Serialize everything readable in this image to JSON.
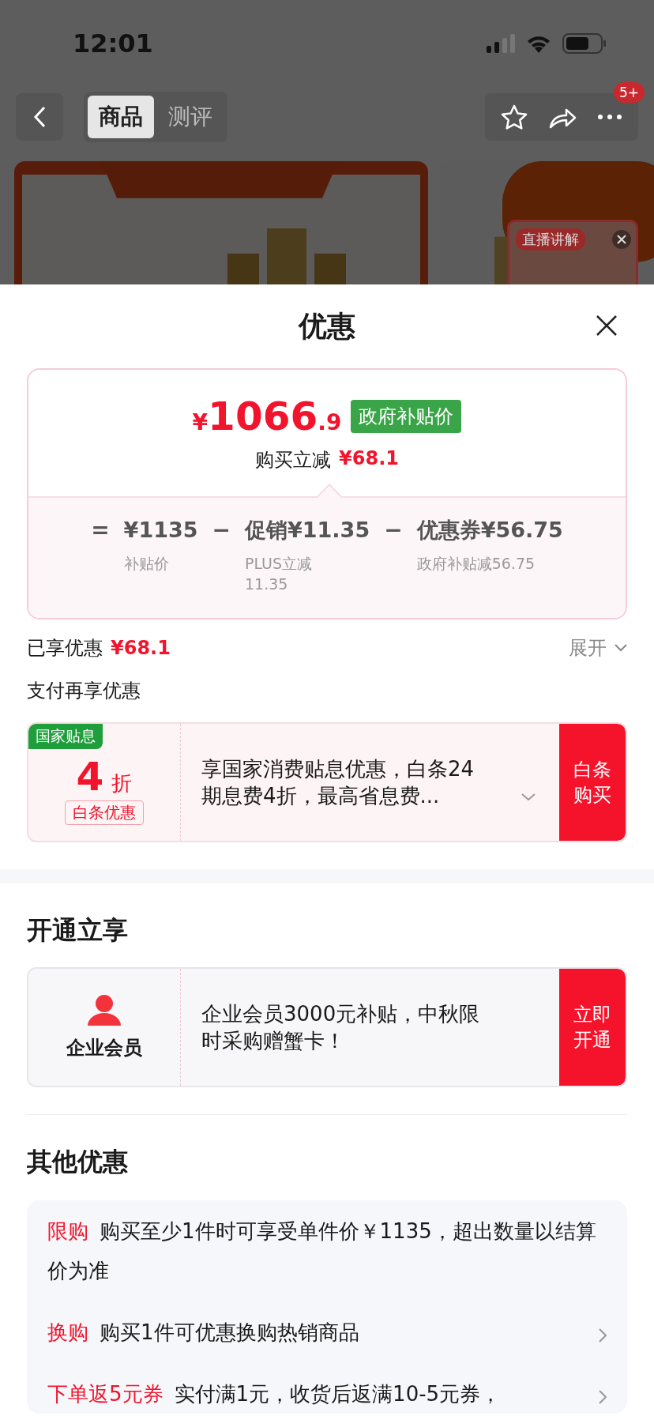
{
  "status_bar": {
    "time": "12:01"
  },
  "nav": {
    "tabs": [
      {
        "label": "商品",
        "selected": true
      },
      {
        "label": "测评",
        "selected": false
      }
    ],
    "badge": "5+"
  },
  "live_window": {
    "label": "直播讲解"
  },
  "sheet": {
    "title": "优惠",
    "price_card": {
      "currency": "¥",
      "price_int": "1066",
      "price_dec": ".9",
      "tag": "政府补贴价",
      "saving_label": "购买立减",
      "saving": "¥68.1",
      "breakdown": [
        {
          "op": "=",
          "value": "¥1135",
          "note": "补贴价"
        },
        {
          "op": "−",
          "value": "促销¥11.35",
          "note": "PLUS立减11.35"
        },
        {
          "op": "−",
          "value": "优惠券¥56.75",
          "note": "政府补贴减56.75"
        }
      ]
    },
    "enjoyed": {
      "label": "已享优惠",
      "amount": "¥68.1",
      "expand": "展开"
    },
    "pay_section": {
      "title": "支付再享优惠",
      "offer": {
        "tag": "国家贴息",
        "discount": "4",
        "unit": "折",
        "badge": "白条优惠",
        "text": "享国家消费贴息优惠，白条24期息费4折，最高省息费...",
        "button": "白条购买"
      }
    },
    "open_section": {
      "title": "开通立享",
      "offer": {
        "name": "企业会员",
        "text": "企业会员3000元补贴，中秋限时采购赠蟹卡！",
        "button": "立即开通"
      }
    },
    "other_section": {
      "title": "其他优惠",
      "items": [
        {
          "label": "限购",
          "text": "购买至少1件时可享受单件价￥1135，超出数量以结算价为准",
          "arrow": false
        },
        {
          "label": "换购",
          "text": "购买1件可优惠换购热销商品",
          "arrow": true
        },
        {
          "label": "下单返5元券",
          "text": "实付满1元，收货后返满10-5元券，",
          "arrow": true
        }
      ]
    }
  }
}
